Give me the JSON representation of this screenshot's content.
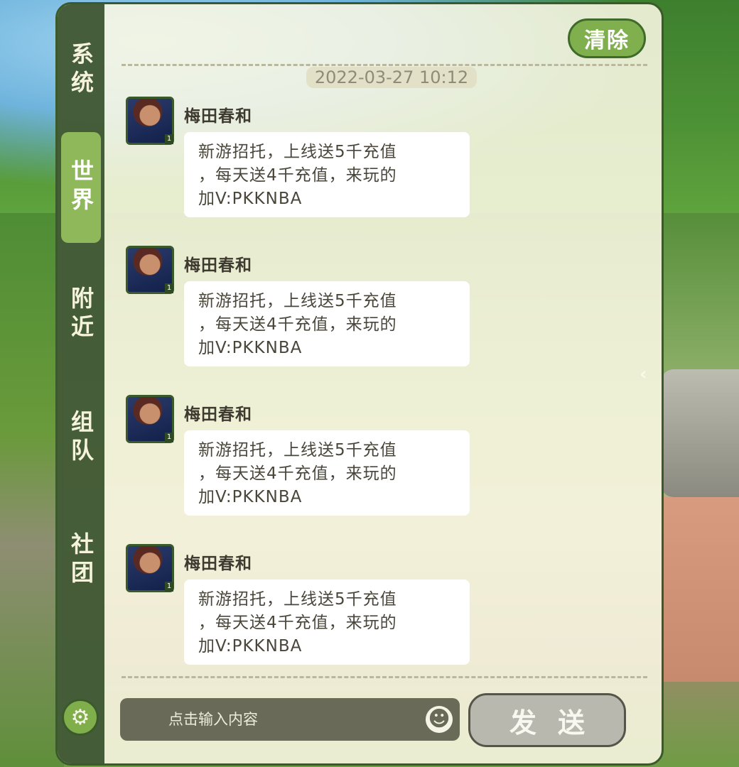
{
  "tabs": {
    "system": "系统",
    "world": "世界",
    "nearby": "附近",
    "team": "组队",
    "club": "社团"
  },
  "header": {
    "clear_label": "清除",
    "timestamp": "2022-03-27 10:12"
  },
  "messages": [
    {
      "username": "梅田春和",
      "line1": "新游招托，上线送5千充值",
      "line2": "，每天送4千充值，来玩的",
      "line3": "加V:PKKNBA",
      "level": "1"
    },
    {
      "username": "梅田春和",
      "line1": "新游招托，上线送5千充值",
      "line2": "，每天送4千充值，来玩的",
      "line3": "加V:PKKNBA",
      "level": "1"
    },
    {
      "username": "梅田春和",
      "line1": "新游招托，上线送5千充值",
      "line2": "，每天送4千充值，来玩的",
      "line3": "加V:PKKNBA",
      "level": "1"
    },
    {
      "username": "梅田春和",
      "line1": "新游招托，上线送5千充值",
      "line2": "，每天送4千充值，来玩的",
      "line3": "加V:PKKNBA",
      "level": "1"
    }
  ],
  "input": {
    "placeholder": "点击输入内容",
    "send_label": "发送"
  },
  "icons": {
    "settings": "gear-icon",
    "emoji": "smiley-icon",
    "collapse": "chevron-left-icon"
  },
  "colors": {
    "accent": "#7fb04d",
    "sidebar": "#2e4822",
    "panel": "#faf8e4"
  }
}
